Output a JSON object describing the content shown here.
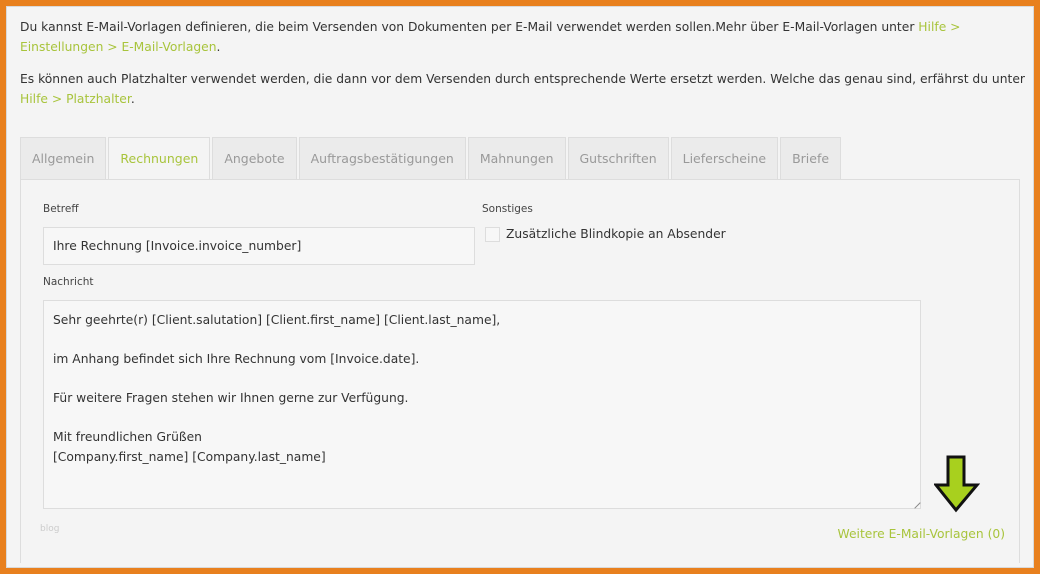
{
  "intro": {
    "p1_text": "Du kannst E-Mail-Vorlagen definieren, die beim Versenden von Dokumenten per E-Mail verwendet werden sollen.Mehr über E-Mail-Vorlagen unter ",
    "p1_link": "Hilfe > Einstellungen > E-Mail-Vorlagen",
    "p1_end": ".",
    "p2_text": "Es können auch Platzhalter verwendet werden, die dann vor dem Versenden durch entsprechende Werte ersetzt werden. Welche das genau sind, erfährst du unter ",
    "p2_link": "Hilfe > Platzhalter",
    "p2_end": "."
  },
  "tabs": [
    {
      "label": "Allgemein"
    },
    {
      "label": "Rechnungen"
    },
    {
      "label": "Angebote"
    },
    {
      "label": "Auftragsbestätigungen"
    },
    {
      "label": "Mahnungen"
    },
    {
      "label": "Gutschriften"
    },
    {
      "label": "Lieferscheine"
    },
    {
      "label": "Briefe"
    }
  ],
  "form": {
    "subject_label": "Betreff",
    "subject_value": "Ihre Rechnung [Invoice.invoice_number]",
    "other_label": "Sonstiges",
    "bcc_label": "Zusätzliche Blindkopie an Absender",
    "message_label": "Nachricht",
    "message_value": "Sehr geehrte(r) [Client.salutation] [Client.first_name] [Client.last_name],\n\nim Anhang befindet sich Ihre Rechnung vom [Invoice.date].\n\nFür weitere Fragen stehen wir Ihnen gerne zur Verfügung.\n\nMit freundlichen Grüßen\n[Company.first_name] [Company.last_name]",
    "watermark": "blog",
    "more_templates_link": "Weitere E-Mail-Vorlagen (0)"
  },
  "colors": {
    "accent": "#a8c43c",
    "frame": "#e8801e",
    "arrow": "#a8d01e"
  }
}
